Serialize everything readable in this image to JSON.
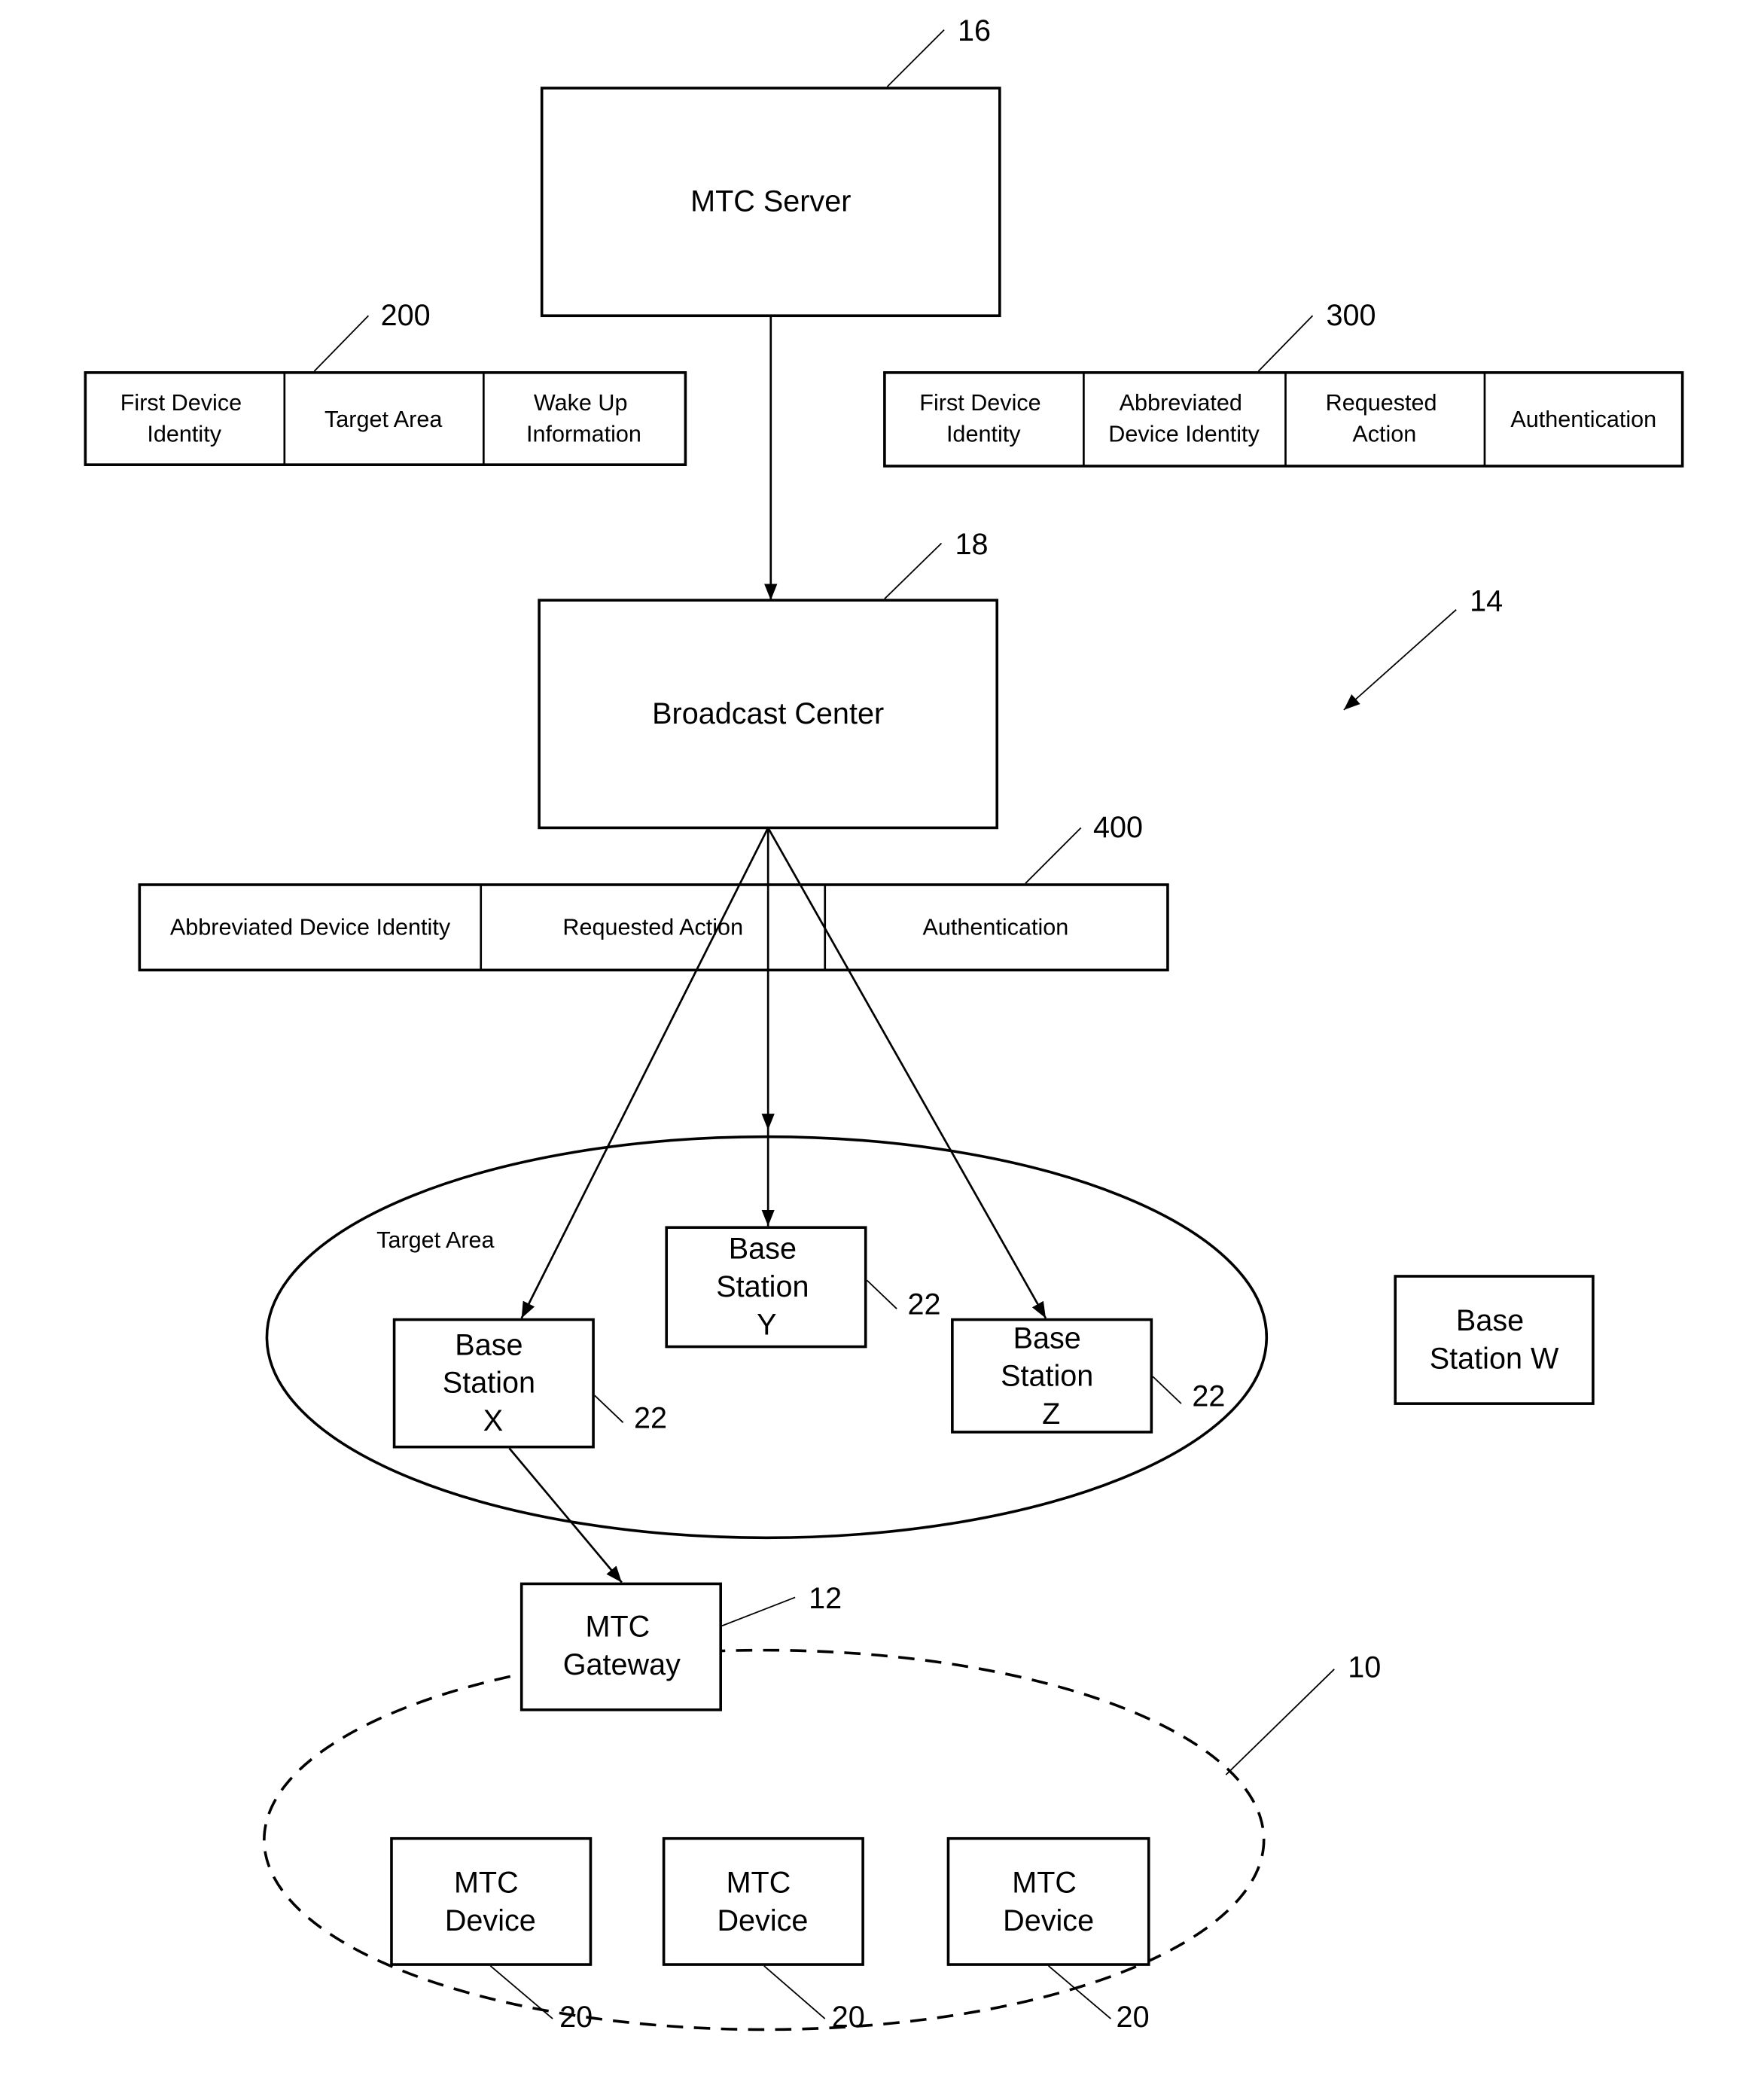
{
  "nodes": {
    "mtc_server": {
      "label": "MTC Server",
      "ref": "16"
    },
    "broadcast_center": {
      "label": "Broadcast Center",
      "ref": "18"
    },
    "base_x": {
      "lines": [
        "Base",
        "Station",
        "X"
      ],
      "ref": "22"
    },
    "base_y": {
      "lines": [
        "Base",
        "Station",
        "Y"
      ],
      "ref": "22"
    },
    "base_z": {
      "lines": [
        "Base",
        "Station",
        "Z"
      ],
      "ref": "22"
    },
    "base_w": {
      "lines": [
        "Base",
        "Station W"
      ]
    },
    "gateway": {
      "lines": [
        "MTC",
        "Gateway"
      ],
      "ref": "12"
    },
    "devices": [
      {
        "lines": [
          "MTC",
          "Device"
        ],
        "ref": "20"
      },
      {
        "lines": [
          "MTC",
          "Device"
        ],
        "ref": "20"
      },
      {
        "lines": [
          "MTC",
          "Device"
        ],
        "ref": "20"
      }
    ]
  },
  "messages": {
    "m200": {
      "ref": "200",
      "fields": [
        [
          "First Device",
          "Identity"
        ],
        [
          "Target Area"
        ],
        [
          "Wake Up",
          "Information"
        ]
      ]
    },
    "m300": {
      "ref": "300",
      "fields": [
        [
          "First Device",
          "Identity"
        ],
        [
          "Abbreviated",
          "Device Identity"
        ],
        [
          "Requested",
          "Action"
        ],
        [
          "Authentication"
        ]
      ]
    },
    "m400": {
      "ref": "400",
      "fields": [
        "Abbreviated Device Identity",
        "Requested Action",
        "Authentication"
      ]
    }
  },
  "areas": {
    "target_area": {
      "label": "Target Area"
    },
    "device_group": {
      "ref": "10"
    }
  },
  "system_ref": "14"
}
